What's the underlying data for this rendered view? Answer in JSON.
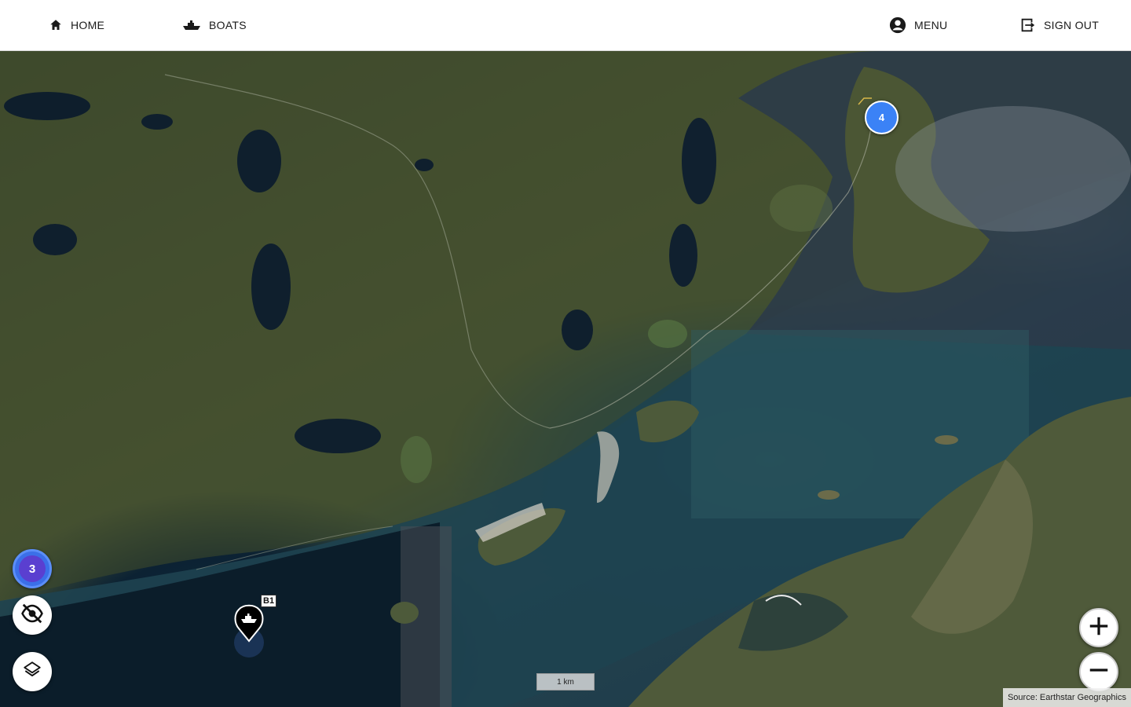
{
  "nav": {
    "home_label": "HOME",
    "boats_label": "BOATS",
    "menu_label": "MENU",
    "signout_label": "SIGN OUT"
  },
  "map": {
    "clusters": [
      {
        "count": "4",
        "color": "#3b82f6"
      },
      {
        "count": "3",
        "color": "#3b6fe8"
      }
    ],
    "boat_marker": {
      "label": "B1",
      "icon": "boat-icon"
    },
    "scale_label": "1 km",
    "attribution": "Source: Earthstar Geographics",
    "controls": {
      "visibility_icon": "eye-off-icon",
      "layers_icon": "layers-icon",
      "zoom_in_icon": "plus-icon",
      "zoom_out_icon": "minus-icon"
    }
  }
}
